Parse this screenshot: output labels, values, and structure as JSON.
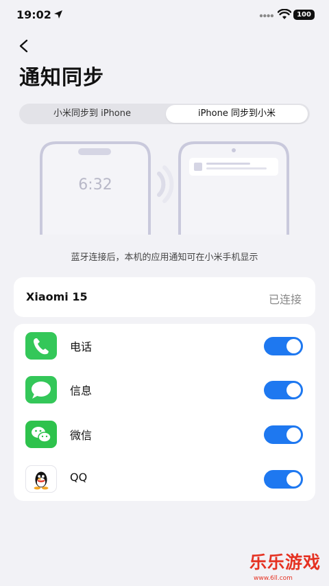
{
  "status_bar": {
    "time": "19:02",
    "battery": "100"
  },
  "page": {
    "title": "通知同步"
  },
  "segment": {
    "options": [
      "小米同步到 iPhone",
      "iPhone 同步到小米"
    ],
    "selected_index": 1
  },
  "illustration": {
    "lock_time": "6:32"
  },
  "caption": "蓝牙连接后，本机的应用通知可在小米手机显示",
  "device": {
    "name": "Xiaomi 15",
    "status": "已连接"
  },
  "apps": [
    {
      "label": "电话",
      "icon": "phone-icon",
      "enabled": true
    },
    {
      "label": "信息",
      "icon": "messages-icon",
      "enabled": true
    },
    {
      "label": "微信",
      "icon": "wechat-icon",
      "enabled": true
    },
    {
      "label": "QQ",
      "icon": "qq-icon",
      "enabled": true
    }
  ],
  "colors": {
    "accent": "#1e78f0",
    "background": "#f2f2f6",
    "app_green": "#34c759"
  },
  "watermark": {
    "text": "乐乐游戏",
    "url": "www.6ll.com"
  }
}
